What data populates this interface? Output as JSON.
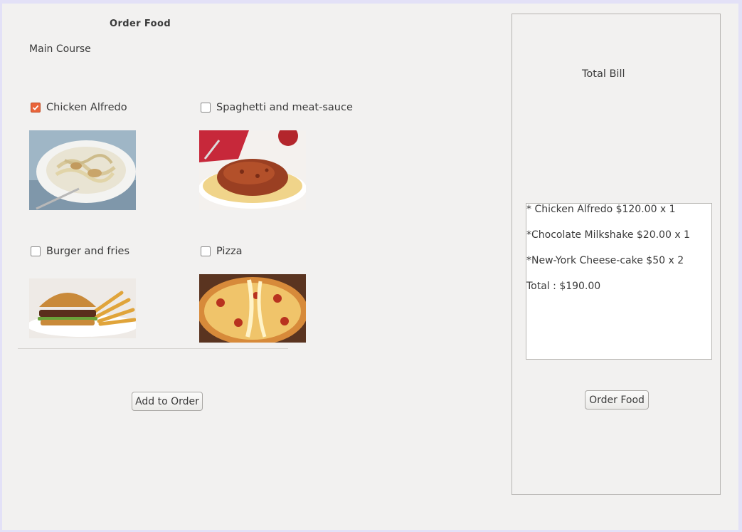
{
  "header": {
    "title": "Order Food"
  },
  "menu": {
    "section_label": "Main Course",
    "items": [
      {
        "label": "Chicken Alfredo",
        "checked": true,
        "image": "chicken-alfredo-photo"
      },
      {
        "label": "Spaghetti and meat-sauce",
        "checked": false,
        "image": "spaghetti-photo"
      },
      {
        "label": "Burger and fries",
        "checked": false,
        "image": "burger-photo"
      },
      {
        "label": "Pizza",
        "checked": false,
        "image": "pizza-photo"
      }
    ],
    "add_button_label": "Add to Order"
  },
  "bill": {
    "title": "Total Bill",
    "lines": [
      "* Chicken Alfredo $120.00 x 1",
      "*Chocolate Milkshake $20.00 x 1",
      "*New-York Cheese-cake $50 x 2",
      "Total : $190.00"
    ],
    "order_button_label": "Order Food"
  },
  "colors": {
    "window_bg": "#f2f1f0",
    "frame_border": "#e3e1f7",
    "checkbox_checked": "#e9643a"
  }
}
